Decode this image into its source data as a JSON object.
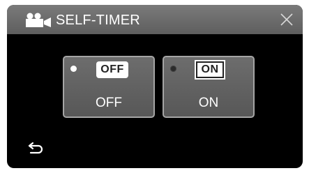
{
  "header": {
    "title": "SELF-TIMER",
    "mode_icon": "movie-camera-icon",
    "close_icon": "close-x-icon"
  },
  "options": [
    {
      "badge": "OFF",
      "label": "OFF",
      "selected": true
    },
    {
      "badge": "ON",
      "label": "ON",
      "selected": false
    }
  ],
  "footer": {
    "back_icon": "return-arrow-icon"
  },
  "colors": {
    "screen_background": "#000000",
    "header_background": "#6a6a6a",
    "button_background": "#626262",
    "button_border": "#a5a5a5",
    "text": "#ffffff"
  }
}
